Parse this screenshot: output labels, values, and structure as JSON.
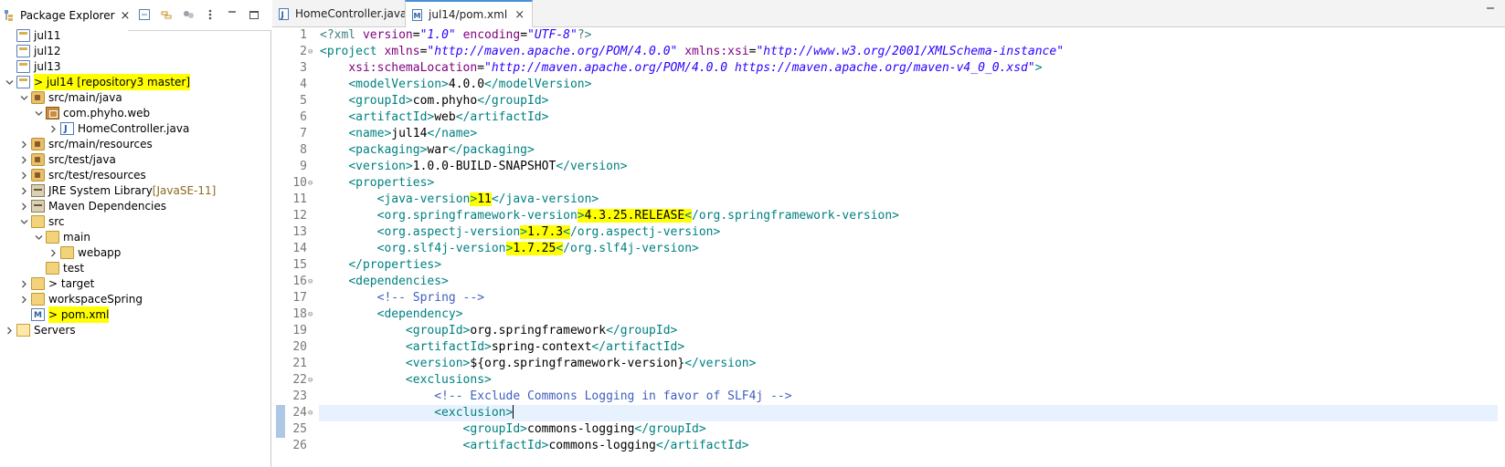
{
  "package_explorer": {
    "tab_label": "Package Explorer",
    "close_glyph": "×",
    "toolbar_icons": [
      "collapse-all-icon",
      "link-with-editor-icon",
      "filter-icon",
      "view-menu-icon",
      "minimize-icon",
      "maximize-icon"
    ],
    "tree": [
      {
        "id": "jul11",
        "label": "jul11",
        "depth": 0,
        "icon": "project-icon",
        "chevron": ""
      },
      {
        "id": "jul12",
        "label": "jul12",
        "depth": 0,
        "icon": "project-icon",
        "chevron": ""
      },
      {
        "id": "jul13",
        "label": "jul13",
        "depth": 0,
        "icon": "project-icon",
        "chevron": ""
      },
      {
        "id": "jul14",
        "label": "> jul14 [repository3 master]",
        "depth": 0,
        "icon": "project-icon",
        "chevron": "expanded",
        "highlight": true
      },
      {
        "id": "src-main-java",
        "label": "src/main/java",
        "depth": 1,
        "icon": "source-folder-icon",
        "chevron": "expanded"
      },
      {
        "id": "com-phyho-web",
        "label": "com.phyho.web",
        "depth": 2,
        "icon": "package-icon",
        "chevron": "expanded"
      },
      {
        "id": "homecontroller",
        "label": "HomeController.java",
        "depth": 3,
        "icon": "java-file-icon",
        "chevron": "collapsed"
      },
      {
        "id": "src-main-resources",
        "label": "src/main/resources",
        "depth": 1,
        "icon": "source-folder-icon",
        "chevron": "collapsed"
      },
      {
        "id": "src-test-java",
        "label": "src/test/java",
        "depth": 1,
        "icon": "source-folder-icon",
        "chevron": "collapsed"
      },
      {
        "id": "src-test-resources",
        "label": "src/test/resources",
        "depth": 1,
        "icon": "source-folder-icon",
        "chevron": "collapsed"
      },
      {
        "id": "jre",
        "label": "JRE System Library",
        "deco": "[JavaSE-11]",
        "depth": 1,
        "icon": "library-icon",
        "chevron": "collapsed"
      },
      {
        "id": "maven-deps",
        "label": "Maven Dependencies",
        "depth": 1,
        "icon": "library-icon",
        "chevron": "collapsed"
      },
      {
        "id": "src",
        "label": "src",
        "depth": 1,
        "icon": "folder-icon",
        "chevron": "expanded"
      },
      {
        "id": "main",
        "label": "main",
        "depth": 2,
        "icon": "folder-icon",
        "chevron": "expanded"
      },
      {
        "id": "webapp",
        "label": "webapp",
        "depth": 3,
        "icon": "folder-icon",
        "chevron": "collapsed"
      },
      {
        "id": "test",
        "label": "test",
        "depth": 2,
        "icon": "folder-icon",
        "chevron": ""
      },
      {
        "id": "target",
        "label": "> target",
        "depth": 1,
        "icon": "folder-icon",
        "chevron": "collapsed"
      },
      {
        "id": "workspaceSpring",
        "label": "workspaceSpring",
        "depth": 1,
        "icon": "folder-icon",
        "chevron": "collapsed"
      },
      {
        "id": "pom-xml",
        "label": "> pom.xml",
        "depth": 1,
        "icon": "xml-file-icon",
        "chevron": "",
        "highlight": true
      },
      {
        "id": "servers",
        "label": "Servers",
        "depth": 0,
        "icon": "servers-icon",
        "chevron": "collapsed"
      }
    ]
  },
  "editor": {
    "tabs": [
      {
        "label": "HomeController.java",
        "active": false
      },
      {
        "label": "jul14/pom.xml",
        "active": true
      }
    ],
    "close_glyph": "×",
    "current_line": 24,
    "lines": [
      {
        "n": "1",
        "fold": "",
        "tokens": [
          [
            "pi",
            "<?xml "
          ],
          [
            "attr",
            "version"
          ],
          [
            "txt",
            "="
          ],
          [
            "str",
            "\"1.0\""
          ],
          [
            "txt",
            " "
          ],
          [
            "attr",
            "encoding"
          ],
          [
            "txt",
            "="
          ],
          [
            "str",
            "\"UTF-8\""
          ],
          [
            "pi",
            "?>"
          ]
        ]
      },
      {
        "n": "2",
        "fold": "⊖",
        "tokens": [
          [
            "br",
            "<project "
          ],
          [
            "attr",
            "xmlns"
          ],
          [
            "txt",
            "="
          ],
          [
            "str",
            "\"http://maven.apache.org/POM/4.0.0\""
          ],
          [
            "txt",
            " "
          ],
          [
            "attr",
            "xmlns:xsi"
          ],
          [
            "txt",
            "="
          ],
          [
            "str",
            "\"http://www.w3.org/2001/XMLSchema-instance\""
          ]
        ]
      },
      {
        "n": "3",
        "fold": "",
        "tokens": [
          [
            "txt",
            "    "
          ],
          [
            "attr",
            "xsi:schemaLocation"
          ],
          [
            "txt",
            "="
          ],
          [
            "str",
            "\"http://maven.apache.org/POM/4.0.0 https://maven.apache.org/maven-v4_0_0.xsd\""
          ],
          [
            "br",
            ">"
          ]
        ]
      },
      {
        "n": "4",
        "fold": "",
        "tokens": [
          [
            "txt",
            "    "
          ],
          [
            "br",
            "<modelVersion>"
          ],
          [
            "txt",
            "4.0.0"
          ],
          [
            "br",
            "</modelVersion>"
          ]
        ]
      },
      {
        "n": "5",
        "fold": "",
        "tokens": [
          [
            "txt",
            "    "
          ],
          [
            "br",
            "<groupId>"
          ],
          [
            "txt",
            "com.phyho"
          ],
          [
            "br",
            "</groupId>"
          ]
        ]
      },
      {
        "n": "6",
        "fold": "",
        "tokens": [
          [
            "txt",
            "    "
          ],
          [
            "br",
            "<artifactId>"
          ],
          [
            "txt",
            "web"
          ],
          [
            "br",
            "</artifactId>"
          ]
        ]
      },
      {
        "n": "7",
        "fold": "",
        "tokens": [
          [
            "txt",
            "    "
          ],
          [
            "br",
            "<name>"
          ],
          [
            "txt",
            "jul14"
          ],
          [
            "br",
            "</name>"
          ]
        ]
      },
      {
        "n": "8",
        "fold": "",
        "tokens": [
          [
            "txt",
            "    "
          ],
          [
            "br",
            "<packaging>"
          ],
          [
            "txt",
            "war"
          ],
          [
            "br",
            "</packaging>"
          ]
        ]
      },
      {
        "n": "9",
        "fold": "",
        "tokens": [
          [
            "txt",
            "    "
          ],
          [
            "br",
            "<version>"
          ],
          [
            "txt",
            "1.0.0-BUILD-SNAPSHOT"
          ],
          [
            "br",
            "</version>"
          ]
        ]
      },
      {
        "n": "10",
        "fold": "⊖",
        "tokens": [
          [
            "txt",
            "    "
          ],
          [
            "br",
            "<properties>"
          ]
        ]
      },
      {
        "n": "11",
        "fold": "",
        "tokens": [
          [
            "txt",
            "        "
          ],
          [
            "br",
            "<java-version"
          ],
          [
            "brhl",
            ">"
          ],
          [
            "txthl",
            "11"
          ],
          [
            "br",
            "</java-version>"
          ]
        ]
      },
      {
        "n": "12",
        "fold": "",
        "tokens": [
          [
            "txt",
            "        "
          ],
          [
            "br",
            "<org.springframework-version"
          ],
          [
            "brhl",
            ">"
          ],
          [
            "txthl",
            "4.3.25.RELEASE"
          ],
          [
            "brhl",
            "<"
          ],
          [
            "br",
            "/org.springframework-version>"
          ]
        ]
      },
      {
        "n": "13",
        "fold": "",
        "tokens": [
          [
            "txt",
            "        "
          ],
          [
            "br",
            "<org.aspectj-version"
          ],
          [
            "brhl",
            ">"
          ],
          [
            "txthl",
            "1.7.3"
          ],
          [
            "brhl",
            "<"
          ],
          [
            "br",
            "/org.aspectj-version>"
          ]
        ]
      },
      {
        "n": "14",
        "fold": "",
        "tokens": [
          [
            "txt",
            "        "
          ],
          [
            "br",
            "<org.slf4j-version"
          ],
          [
            "brhl",
            ">"
          ],
          [
            "txthl",
            "1.7.25"
          ],
          [
            "brhl",
            "<"
          ],
          [
            "br",
            "/org.slf4j-version>"
          ]
        ]
      },
      {
        "n": "15",
        "fold": "",
        "tokens": [
          [
            "txt",
            "    "
          ],
          [
            "br",
            "</properties>"
          ]
        ]
      },
      {
        "n": "16",
        "fold": "⊖",
        "tokens": [
          [
            "txt",
            "    "
          ],
          [
            "br",
            "<dependencies>"
          ]
        ]
      },
      {
        "n": "17",
        "fold": "",
        "tokens": [
          [
            "txt",
            "        "
          ],
          [
            "cm",
            "<!-- Spring -->"
          ]
        ]
      },
      {
        "n": "18",
        "fold": "⊖",
        "tokens": [
          [
            "txt",
            "        "
          ],
          [
            "br",
            "<dependency>"
          ]
        ]
      },
      {
        "n": "19",
        "fold": "",
        "tokens": [
          [
            "txt",
            "            "
          ],
          [
            "br",
            "<groupId>"
          ],
          [
            "txt",
            "org.springframework"
          ],
          [
            "br",
            "</groupId>"
          ]
        ]
      },
      {
        "n": "20",
        "fold": "",
        "tokens": [
          [
            "txt",
            "            "
          ],
          [
            "br",
            "<artifactId>"
          ],
          [
            "txt",
            "spring-context"
          ],
          [
            "br",
            "</artifactId>"
          ]
        ]
      },
      {
        "n": "21",
        "fold": "",
        "tokens": [
          [
            "txt",
            "            "
          ],
          [
            "br",
            "<version>"
          ],
          [
            "txt",
            "${org.springframework-version}"
          ],
          [
            "br",
            "</version>"
          ]
        ]
      },
      {
        "n": "22",
        "fold": "⊖",
        "tokens": [
          [
            "txt",
            "            "
          ],
          [
            "br",
            "<exclusions>"
          ]
        ]
      },
      {
        "n": "23",
        "fold": "",
        "tokens": [
          [
            "txt",
            "                "
          ],
          [
            "cm",
            "<!-- Exclude Commons Logging in favor of SLF4j -->"
          ]
        ]
      },
      {
        "n": "24",
        "fold": "⊖",
        "tokens": [
          [
            "txt",
            "                "
          ],
          [
            "br",
            "<exclusion>"
          ],
          [
            "caret",
            ""
          ]
        ]
      },
      {
        "n": "25",
        "fold": "",
        "tokens": [
          [
            "txt",
            "                    "
          ],
          [
            "br",
            "<groupId>"
          ],
          [
            "txt",
            "commons-logging"
          ],
          [
            "br",
            "</groupId>"
          ]
        ]
      },
      {
        "n": "26",
        "fold": "",
        "tokens": [
          [
            "txt",
            "                    "
          ],
          [
            "br",
            "<artifactId>"
          ],
          [
            "txt",
            "commons-logging"
          ],
          [
            "br",
            "</artifactId>"
          ]
        ]
      }
    ]
  },
  "colors": {
    "highlight": "#ffff00",
    "tag": "#008080",
    "attribute": "#7f007f",
    "string": "#2a00ff",
    "comment": "#3f5fbf",
    "decoration": "#8b6a1d",
    "current_line": "#e8f2fe"
  }
}
